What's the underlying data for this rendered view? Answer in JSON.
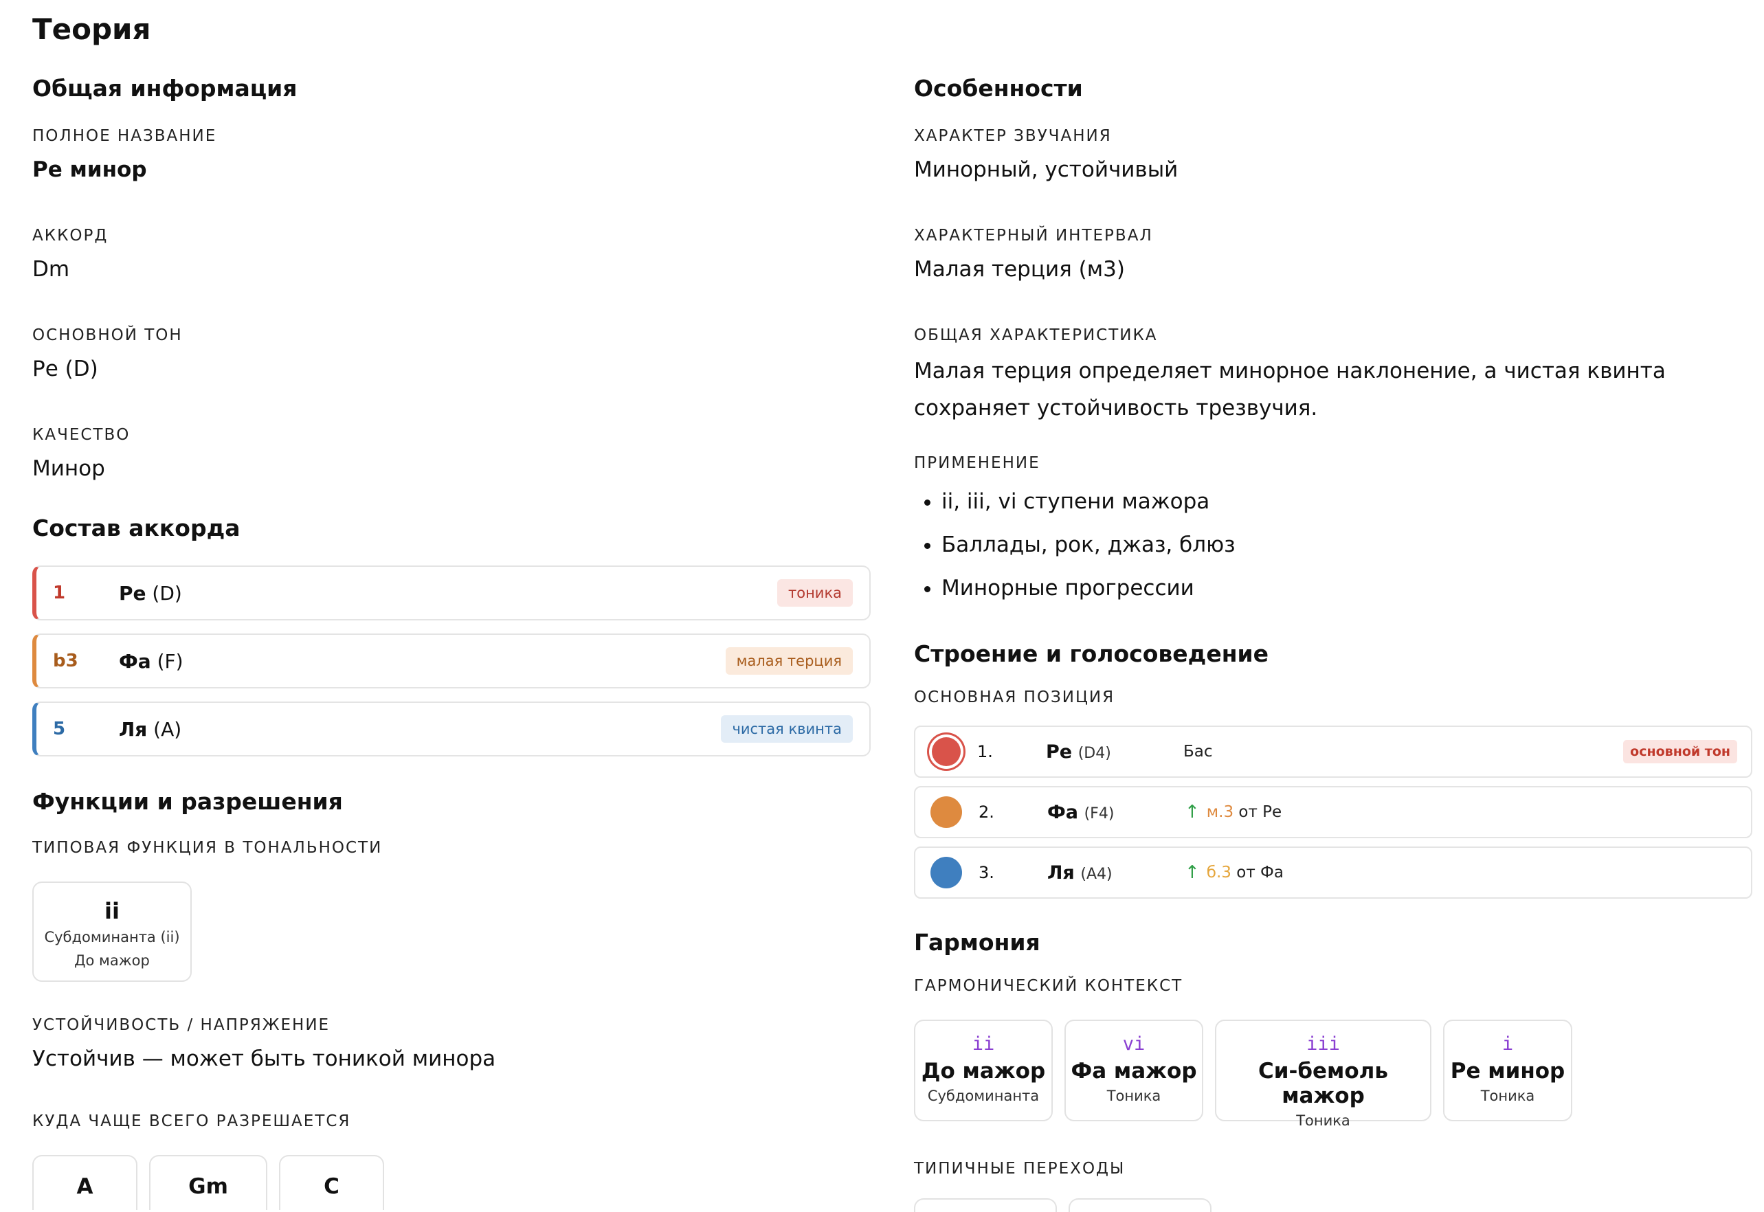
{
  "page": {
    "title": "Теория"
  },
  "general": {
    "title": "Общая информация",
    "fields": [
      {
        "label": "Полное название",
        "value": "Ре минор",
        "bold": true
      },
      {
        "label": "Аккорд",
        "value": "Dm"
      },
      {
        "label": "Основной тон",
        "value": "Ре (D)"
      },
      {
        "label": "Качество",
        "value": "Минор"
      }
    ]
  },
  "composition": {
    "title": "Состав аккорда",
    "notes": [
      {
        "interval": "1",
        "name": "Ре",
        "letter": "(D)",
        "tag": "тоника",
        "color": "#d9534a",
        "tag_bg": "#fbe6e3",
        "tag_fg": "#b3392f"
      },
      {
        "interval": "b3",
        "name": "Фа",
        "letter": "(F)",
        "tag": "малая терция",
        "color": "#de8a3f",
        "tag_bg": "#fbeadc",
        "tag_fg": "#a85c1c"
      },
      {
        "interval": "5",
        "name": "Ля",
        "letter": "(A)",
        "tag": "чистая квинта",
        "color": "#3f7fbf",
        "tag_bg": "#e3edf7",
        "tag_fg": "#2c6aa5"
      }
    ]
  },
  "functions": {
    "title": "Функции и разрешения",
    "typical_label": "Типовая функция в тональности",
    "typical": {
      "numeral": "ii",
      "func": "Субдоминанта (ii)",
      "key": "До мажор"
    },
    "stability_label": "Устойчивость / напряжение",
    "stability_value": "Устойчив — может быть тоникой минора",
    "resolves_label": "Куда чаще всего разрешается",
    "resolves": [
      "A",
      "Gm",
      "C"
    ]
  },
  "features": {
    "title": "Особенности",
    "sound_label": "Характер звучания",
    "sound_value": "Минорный, устойчивый",
    "interval_label": "Характерный интервал",
    "interval_value": "Малая терция (м3)",
    "general_label": "Общая характеристика",
    "general_value": "Малая терция определяет минорное наклонение, а чистая квинта сохраняет устойчивость трезвучия.",
    "usage_label": "Применение",
    "usage": [
      "ii, iii, vi ступени мажора",
      "Баллады, рок, джаз, блюз",
      "Минорные прогрессии"
    ]
  },
  "voicing": {
    "title": "Строение и голосоведение",
    "label": "Основная позиция",
    "rows": [
      {
        "no": "1.",
        "name": "Ре",
        "octave": "(D4)",
        "role": "Бас",
        "tag": "основной тон",
        "color": "#d9534a"
      },
      {
        "no": "2.",
        "name": "Фа",
        "octave": "(F4)",
        "interval": "м.3",
        "interval_color": "#de8a3f",
        "from": "от Ре",
        "color": "#de8a3f"
      },
      {
        "no": "3.",
        "name": "Ля",
        "octave": "(A4)",
        "interval": "б.3",
        "interval_color": "#e5a53a",
        "from": "от Фа",
        "color": "#3f7fbf"
      }
    ]
  },
  "harmony": {
    "title": "Гармония",
    "context_label": "Гармонический контекст",
    "context": [
      {
        "numeral": "ii",
        "key": "До мажор",
        "func": "Субдоминанта"
      },
      {
        "numeral": "vi",
        "key": "Фа мажор",
        "func": "Тоника"
      },
      {
        "numeral": "iii",
        "key": "Си-бемоль мажор",
        "func": "Тоника"
      },
      {
        "numeral": "i",
        "key": "Ре минор",
        "func": "Тоника"
      }
    ],
    "transitions_label": "Типичные переходы"
  }
}
